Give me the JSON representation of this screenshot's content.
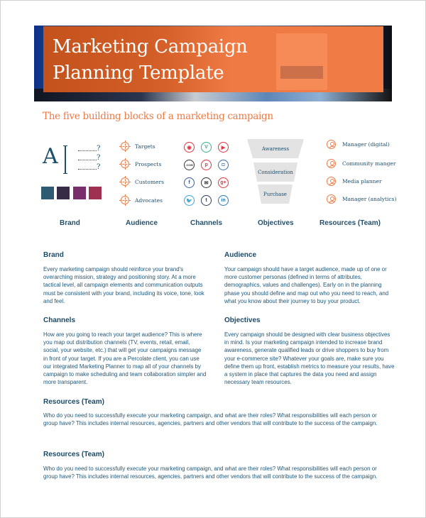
{
  "header": {
    "title_line1": "Marketing Campaign",
    "title_line2": "Planning Template",
    "accent_color": "#ee7a45"
  },
  "subtitle": "The five building blocks of a marketing campaign",
  "brand_graphic": {
    "letter": "A",
    "question_marks": [
      "?",
      "?",
      "?"
    ],
    "swatches": [
      "#2e5a73",
      "#372c45",
      "#7a2f6b",
      "#a0304f"
    ]
  },
  "audience_graphic": {
    "items": [
      {
        "label": "Targets",
        "icon": "target-icon"
      },
      {
        "label": "Prospects",
        "icon": "target-icon"
      },
      {
        "label": "Customers",
        "icon": "target-icon"
      },
      {
        "label": "Advocates",
        "icon": "target-icon"
      }
    ]
  },
  "channels_graphic": {
    "icons": [
      {
        "name": "weibo-icon",
        "glyph": "◉",
        "color": "#e0343f"
      },
      {
        "name": "vine-icon",
        "glyph": "V",
        "color": "#2fb587"
      },
      {
        "name": "youtube-icon",
        "glyph": "▶",
        "color": "#e0343f"
      },
      {
        "name": "dotcom-icon",
        "glyph": ".COM",
        "color": "#333333"
      },
      {
        "name": "pinterest-icon",
        "glyph": "p",
        "color": "#e0343f"
      },
      {
        "name": "instagram-icon",
        "glyph": "◘",
        "color": "#3c6fa0"
      },
      {
        "name": "facebook-icon",
        "glyph": "f",
        "color": "#3b5b9a"
      },
      {
        "name": "email-icon",
        "glyph": "✉",
        "color": "#333333"
      },
      {
        "name": "google-plus-icon",
        "glyph": "g+",
        "color": "#e0343f"
      },
      {
        "name": "twitter-icon",
        "glyph": "🐦",
        "color": "#35a9e0"
      },
      {
        "name": "tumblr-icon",
        "glyph": "t",
        "color": "#2f3f54"
      },
      {
        "name": "linkedin-icon",
        "glyph": "in",
        "color": "#2a77b0"
      }
    ]
  },
  "objectives_graphic": {
    "funnel": [
      "Awareness",
      "Consideration",
      "Purchase"
    ]
  },
  "team_graphic": {
    "items": [
      {
        "label": "Manager (digital)",
        "icon": "person-icon"
      },
      {
        "label": "Community manger",
        "icon": "person-icon"
      },
      {
        "label": "Media planner",
        "icon": "person-icon"
      },
      {
        "label": "Manager (analytics)",
        "icon": "person-icon"
      }
    ]
  },
  "column_labels": [
    "Brand",
    "Audience",
    "Channels",
    "Objectives",
    "Resources (Team)"
  ],
  "sections": {
    "brand": {
      "title": "Brand",
      "body": "Every marketing campaign should reinforce your brand's overarching mission, strategy and positioning story. At a more tactical level, all campaign elements and communication outputs must be consistent with your brand, including its voice, tone, look and feel."
    },
    "audience": {
      "title": "Audience",
      "body": "Your campaign should have a target audience, made up of one or more customer personas (defined in terms of attributes, demographics, values and challenges). Early on in the planning phase you should define and map out who you need to reach, and what you know about their journey to buy your product."
    },
    "channels": {
      "title": "Channels",
      "body": "How are you going to reach your target audience? This is where you map out distribution channels (TV, events, retail, email, social, your website, etc.) that will get your campaigns message in front of your target. If you are a Percolate client, you can use our integrated Marketing Planner to map all of your channels by campaign to make scheduling and team collaboration simpler and more transparent."
    },
    "objectives": {
      "title": "Objectives",
      "body": "Every campaign should be designed with clear business objectives in mind. Is your marketing campaign intended to increase brand awareness, generate qualified leads or drive shoppers to buy from your e-commerce site? Whatever your goals are, make sure you define them up front, establish metrics to measure your results, have a system in place that captures the data you need and assign necessary team resources."
    },
    "resources_1": {
      "title": "Resources (Team)",
      "body": "Who do you need to successfully execute your marketing campaign, and what are their roles? What responsibilities will each person or group have? This includes internal resources, agencies, partners and other vendors that will contribute to the success of the campaign."
    },
    "resources_2": {
      "title": "Resources (Team)",
      "body": "Who do you need to successfully execute your marketing campaign, and what are their roles? What responsibilities will each person or group have? This includes internal resources, agencies, partners and other vendors that will contribute to the success of the campaign."
    }
  }
}
